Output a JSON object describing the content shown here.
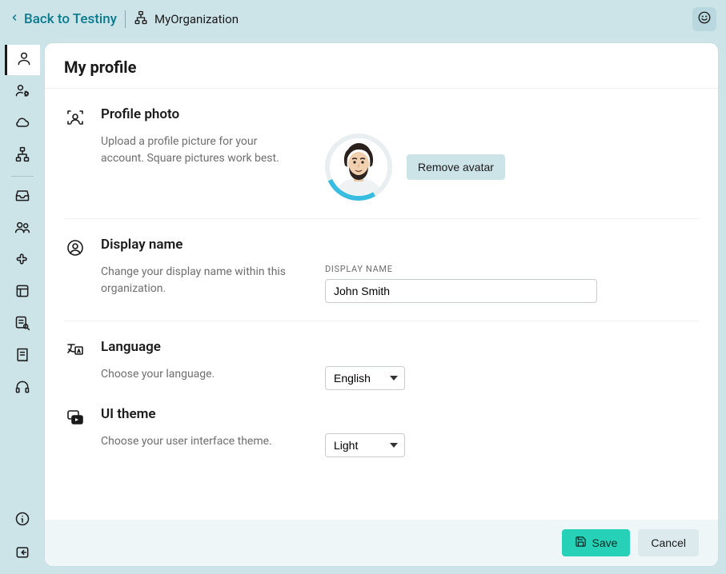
{
  "header": {
    "back_label": "Back to Testiny",
    "org_name": "MyOrganization"
  },
  "page": {
    "title": "My profile"
  },
  "profile_photo": {
    "heading": "Profile photo",
    "description": "Upload a profile picture for your account. Square pictures work best.",
    "remove_label": "Remove avatar"
  },
  "display_name": {
    "heading": "Display name",
    "description": "Change your display name within this organization.",
    "field_label": "DISPLAY NAME",
    "value": "John Smith"
  },
  "language": {
    "heading": "Language",
    "description": "Choose your language.",
    "value": "English"
  },
  "ui_theme": {
    "heading": "UI theme",
    "description": "Choose your user interface theme.",
    "value": "Light"
  },
  "footer": {
    "save_label": "Save",
    "cancel_label": "Cancel"
  }
}
